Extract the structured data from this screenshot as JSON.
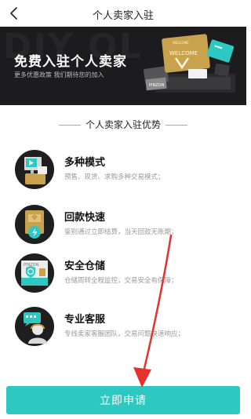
{
  "nav": {
    "title": "个人卖家入驻",
    "back_icon": "chevron-left-icon"
  },
  "banner": {
    "bg_text": "DIY OL",
    "headline": "免费入驻个人卖家",
    "subtitle": "更多优惠政策 我们期待您的加入",
    "illustration_text": "WELCOME",
    "illustration_small": "PINZON",
    "illustration_mini": "WELCOME"
  },
  "section": {
    "title": "个人卖家入驻优势"
  },
  "advantages": [
    {
      "icon": "monitor-cart-icon",
      "name": "多种模式",
      "desc": "预售、现货、求购多种交易模式；"
    },
    {
      "icon": "payment-card-icon",
      "name": "回款快速",
      "desc": "鉴别通过立即结算，当天回款无账期；"
    },
    {
      "icon": "shield-box-icon",
      "name": "安全仓储",
      "desc": "仓储周转全程监控，交易安全有保障；",
      "box_label": "PINZON"
    },
    {
      "icon": "customer-service-icon",
      "name": "专业客服",
      "desc": "专线卖家客服团队，交易问题快速响应；"
    }
  ],
  "cta": {
    "label": "立即申请"
  },
  "colors": {
    "accent": "#2dc8c1",
    "banner_bg": "#1c1c1e",
    "gold": "#c9a24e",
    "arrow": "#e5322d",
    "icon_circle": "#1f1f1f"
  }
}
